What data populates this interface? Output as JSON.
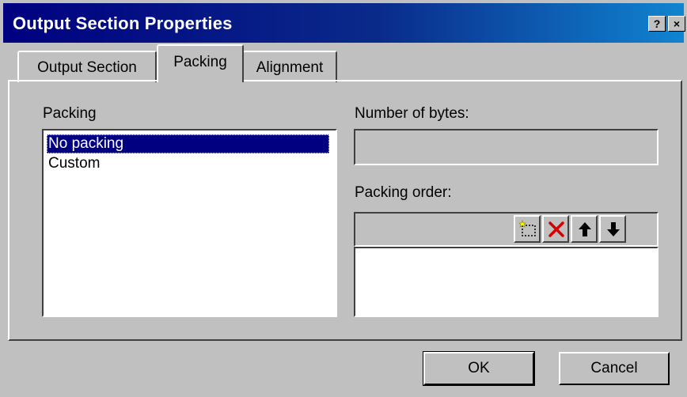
{
  "window": {
    "title": "Output Section Properties",
    "help_glyph": "?",
    "close_glyph": "×"
  },
  "tabs": [
    {
      "label": "Output Section",
      "selected": false
    },
    {
      "label": "Packing",
      "selected": true
    },
    {
      "label": "Alignment",
      "selected": false
    }
  ],
  "packing": {
    "label": "Packing",
    "options": [
      {
        "label": "No packing",
        "selected": true
      },
      {
        "label": "Custom",
        "selected": false
      }
    ]
  },
  "bytes": {
    "label": "Number of bytes:",
    "value": ""
  },
  "order": {
    "label": "Packing order:",
    "toolbar": [
      "new-item-icon",
      "delete-icon",
      "move-up-icon",
      "move-down-icon"
    ],
    "items": []
  },
  "buttons": {
    "ok": "OK",
    "cancel": "Cancel"
  },
  "colors": {
    "titlebar_start": "#000080",
    "titlebar_end": "#1084d0",
    "selection": "#000080",
    "face": "#c0c0c0",
    "delete_icon": "#d40000"
  }
}
